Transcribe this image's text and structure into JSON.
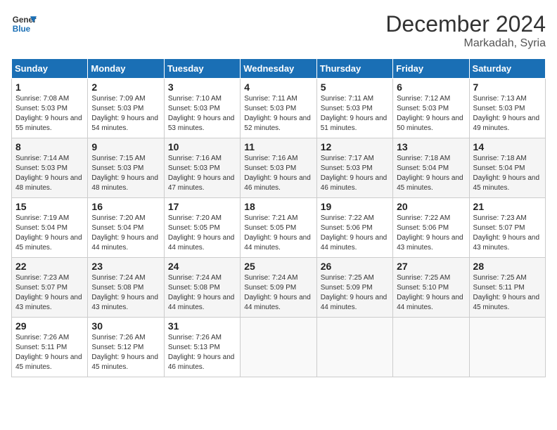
{
  "logo": {
    "line1": "General",
    "line2": "Blue"
  },
  "title": "December 2024",
  "location": "Markadah, Syria",
  "days_of_week": [
    "Sunday",
    "Monday",
    "Tuesday",
    "Wednesday",
    "Thursday",
    "Friday",
    "Saturday"
  ],
  "weeks": [
    [
      {
        "day": "1",
        "rise": "7:08 AM",
        "set": "5:03 PM",
        "daylight": "9 hours and 55 minutes."
      },
      {
        "day": "2",
        "rise": "7:09 AM",
        "set": "5:03 PM",
        "daylight": "9 hours and 54 minutes."
      },
      {
        "day": "3",
        "rise": "7:10 AM",
        "set": "5:03 PM",
        "daylight": "9 hours and 53 minutes."
      },
      {
        "day": "4",
        "rise": "7:11 AM",
        "set": "5:03 PM",
        "daylight": "9 hours and 52 minutes."
      },
      {
        "day": "5",
        "rise": "7:11 AM",
        "set": "5:03 PM",
        "daylight": "9 hours and 51 minutes."
      },
      {
        "day": "6",
        "rise": "7:12 AM",
        "set": "5:03 PM",
        "daylight": "9 hours and 50 minutes."
      },
      {
        "day": "7",
        "rise": "7:13 AM",
        "set": "5:03 PM",
        "daylight": "9 hours and 49 minutes."
      }
    ],
    [
      {
        "day": "8",
        "rise": "7:14 AM",
        "set": "5:03 PM",
        "daylight": "9 hours and 48 minutes."
      },
      {
        "day": "9",
        "rise": "7:15 AM",
        "set": "5:03 PM",
        "daylight": "9 hours and 48 minutes."
      },
      {
        "day": "10",
        "rise": "7:16 AM",
        "set": "5:03 PM",
        "daylight": "9 hours and 47 minutes."
      },
      {
        "day": "11",
        "rise": "7:16 AM",
        "set": "5:03 PM",
        "daylight": "9 hours and 46 minutes."
      },
      {
        "day": "12",
        "rise": "7:17 AM",
        "set": "5:03 PM",
        "daylight": "9 hours and 46 minutes."
      },
      {
        "day": "13",
        "rise": "7:18 AM",
        "set": "5:04 PM",
        "daylight": "9 hours and 45 minutes."
      },
      {
        "day": "14",
        "rise": "7:18 AM",
        "set": "5:04 PM",
        "daylight": "9 hours and 45 minutes."
      }
    ],
    [
      {
        "day": "15",
        "rise": "7:19 AM",
        "set": "5:04 PM",
        "daylight": "9 hours and 45 minutes."
      },
      {
        "day": "16",
        "rise": "7:20 AM",
        "set": "5:04 PM",
        "daylight": "9 hours and 44 minutes."
      },
      {
        "day": "17",
        "rise": "7:20 AM",
        "set": "5:05 PM",
        "daylight": "9 hours and 44 minutes."
      },
      {
        "day": "18",
        "rise": "7:21 AM",
        "set": "5:05 PM",
        "daylight": "9 hours and 44 minutes."
      },
      {
        "day": "19",
        "rise": "7:22 AM",
        "set": "5:06 PM",
        "daylight": "9 hours and 44 minutes."
      },
      {
        "day": "20",
        "rise": "7:22 AM",
        "set": "5:06 PM",
        "daylight": "9 hours and 43 minutes."
      },
      {
        "day": "21",
        "rise": "7:23 AM",
        "set": "5:07 PM",
        "daylight": "9 hours and 43 minutes."
      }
    ],
    [
      {
        "day": "22",
        "rise": "7:23 AM",
        "set": "5:07 PM",
        "daylight": "9 hours and 43 minutes."
      },
      {
        "day": "23",
        "rise": "7:24 AM",
        "set": "5:08 PM",
        "daylight": "9 hours and 43 minutes."
      },
      {
        "day": "24",
        "rise": "7:24 AM",
        "set": "5:08 PM",
        "daylight": "9 hours and 44 minutes."
      },
      {
        "day": "25",
        "rise": "7:24 AM",
        "set": "5:09 PM",
        "daylight": "9 hours and 44 minutes."
      },
      {
        "day": "26",
        "rise": "7:25 AM",
        "set": "5:09 PM",
        "daylight": "9 hours and 44 minutes."
      },
      {
        "day": "27",
        "rise": "7:25 AM",
        "set": "5:10 PM",
        "daylight": "9 hours and 44 minutes."
      },
      {
        "day": "28",
        "rise": "7:25 AM",
        "set": "5:11 PM",
        "daylight": "9 hours and 45 minutes."
      }
    ],
    [
      {
        "day": "29",
        "rise": "7:26 AM",
        "set": "5:11 PM",
        "daylight": "9 hours and 45 minutes."
      },
      {
        "day": "30",
        "rise": "7:26 AM",
        "set": "5:12 PM",
        "daylight": "9 hours and 45 minutes."
      },
      {
        "day": "31",
        "rise": "7:26 AM",
        "set": "5:13 PM",
        "daylight": "9 hours and 46 minutes."
      },
      null,
      null,
      null,
      null
    ]
  ],
  "labels": {
    "sunrise": "Sunrise:",
    "sunset": "Sunset:",
    "daylight": "Daylight:"
  }
}
